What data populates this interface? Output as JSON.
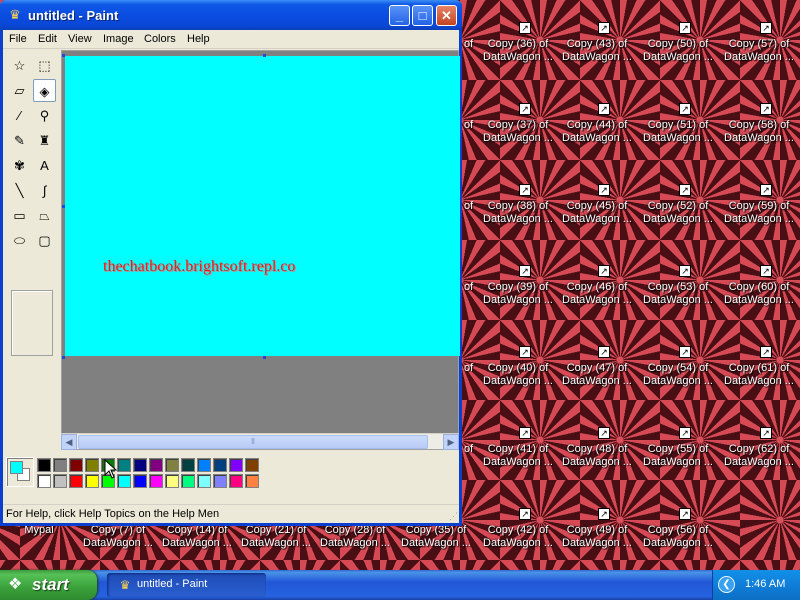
{
  "window": {
    "title": "untitled - Paint",
    "minimize_glyph": "_",
    "maximize_glyph": "□",
    "close_glyph": "✕"
  },
  "menu": [
    "File",
    "Edit",
    "View",
    "Image",
    "Colors",
    "Help"
  ],
  "toolbox": {
    "tools": [
      {
        "name": "free-form-select",
        "glyph": "☆"
      },
      {
        "name": "select",
        "glyph": "⬚"
      },
      {
        "name": "eraser",
        "glyph": "▱"
      },
      {
        "name": "fill-with-color",
        "glyph": "◈"
      },
      {
        "name": "pick-color",
        "glyph": "⁄"
      },
      {
        "name": "magnifier",
        "glyph": "⚲"
      },
      {
        "name": "pencil",
        "glyph": "✎"
      },
      {
        "name": "brush",
        "glyph": "♜"
      },
      {
        "name": "airbrush",
        "glyph": "✾"
      },
      {
        "name": "text",
        "glyph": "A"
      },
      {
        "name": "line",
        "glyph": "╲"
      },
      {
        "name": "curve",
        "glyph": "∫"
      },
      {
        "name": "rectangle",
        "glyph": "▭"
      },
      {
        "name": "polygon",
        "glyph": "⏢"
      },
      {
        "name": "ellipse",
        "glyph": "⬭"
      },
      {
        "name": "rounded-rectangle",
        "glyph": "▢"
      }
    ],
    "active_tool": "fill-with-color"
  },
  "canvas": {
    "background": "#00ffff",
    "text": "thechatbook.brightsoft.repl.co",
    "text_color": "#e02020"
  },
  "scrollbar": {
    "left_glyph": "◀",
    "right_glyph": "▶",
    "thumb_glyph": "⦀"
  },
  "palette": {
    "foreground": "#00ffff",
    "background": "#ffffff",
    "top_row": [
      "#000000",
      "#808080",
      "#800000",
      "#808000",
      "#008000",
      "#008080",
      "#000080",
      "#800080",
      "#808040",
      "#004040",
      "#0080ff",
      "#004080",
      "#8000ff",
      "#804000"
    ],
    "bottom_row": [
      "#ffffff",
      "#c0c0c0",
      "#ff0000",
      "#ffff00",
      "#00ff00",
      "#00ffff",
      "#0000ff",
      "#ff00ff",
      "#ffff80",
      "#00ff80",
      "#80ffff",
      "#8080ff",
      "#ff0080",
      "#ff8040"
    ]
  },
  "status": {
    "text": "For Help, click Help Topics on the Help Men",
    "grip_glyph": "⋰"
  },
  "desktop": {
    "shortcut_arrow": "↗",
    "icons": [
      {
        "col": 0,
        "row": 0,
        "label": "Copy (36) of\nDataWagon ..."
      },
      {
        "col": 1,
        "row": 0,
        "label": "Copy (43) of\nDataWagon ..."
      },
      {
        "col": 2,
        "row": 0,
        "label": "Copy (50) of\nDataWagon ..."
      },
      {
        "col": 3,
        "row": 0,
        "label": "Copy (57) of\nDataWagon ..."
      },
      {
        "col": 0,
        "row": 1,
        "label": "Copy (37) of\nDataWagon ..."
      },
      {
        "col": 1,
        "row": 1,
        "label": "Copy (44) of\nDataWagon ..."
      },
      {
        "col": 2,
        "row": 1,
        "label": "Copy (51) of\nDataWagon ..."
      },
      {
        "col": 3,
        "row": 1,
        "label": "Copy (58) of\nDataWagon ..."
      },
      {
        "col": 0,
        "row": 2,
        "label": "Copy (38) of\nDataWagon ..."
      },
      {
        "col": 1,
        "row": 2,
        "label": "Copy (45) of\nDataWagon ..."
      },
      {
        "col": 2,
        "row": 2,
        "label": "Copy (52) of\nDataWagon ..."
      },
      {
        "col": 3,
        "row": 2,
        "label": "Copy (59) of\nDataWagon ..."
      },
      {
        "col": 0,
        "row": 3,
        "label": "Copy (39) of\nDataWagon ..."
      },
      {
        "col": 1,
        "row": 3,
        "label": "Copy (46) of\nDataWagon ..."
      },
      {
        "col": 2,
        "row": 3,
        "label": "Copy (53) of\nDataWagon ..."
      },
      {
        "col": 3,
        "row": 3,
        "label": "Copy (60) of\nDataWagon ..."
      },
      {
        "col": 0,
        "row": 4,
        "label": "Copy (40) of\nDataWagon ..."
      },
      {
        "col": 1,
        "row": 4,
        "label": "Copy (47) of\nDataWagon ..."
      },
      {
        "col": 2,
        "row": 4,
        "label": "Copy (54) of\nDataWagon ..."
      },
      {
        "col": 3,
        "row": 4,
        "label": "Copy (61) of\nDataWagon ..."
      },
      {
        "col": 0,
        "row": 5,
        "label": "Copy (41) of\nDataWagon ..."
      },
      {
        "col": 1,
        "row": 5,
        "label": "Copy (48) of\nDataWagon ..."
      },
      {
        "col": 2,
        "row": 5,
        "label": "Copy (55) of\nDataWagon ..."
      },
      {
        "col": 3,
        "row": 5,
        "label": "Copy (62) of\nDataWagon ..."
      }
    ],
    "bottom_icons": [
      {
        "label": "Mypal"
      },
      {
        "label": "Copy (7) of\nDataWagon ..."
      },
      {
        "label": "Copy (14) of\nDataWagon ..."
      },
      {
        "label": "Copy (21) of\nDataWagon ..."
      },
      {
        "label": "Copy (28) of\nDataWagon ..."
      },
      {
        "label": "Copy (35) of\nDataWagon ..."
      },
      {
        "label": "Copy (42) of\nDataWagon ..."
      },
      {
        "label": "Copy (49) of\nDataWagon ..."
      },
      {
        "label": "Copy (56) of\nDataWagon ..."
      }
    ],
    "partial_labels": [
      "of",
      "of",
      "of",
      "of",
      "of",
      "of"
    ]
  },
  "taskbar": {
    "start_label": "start",
    "start_glyph": "❖",
    "task_label": "untitled - Paint",
    "task_glyph": "♛",
    "tray_glyph": "❮",
    "clock": "1:46 AM"
  }
}
